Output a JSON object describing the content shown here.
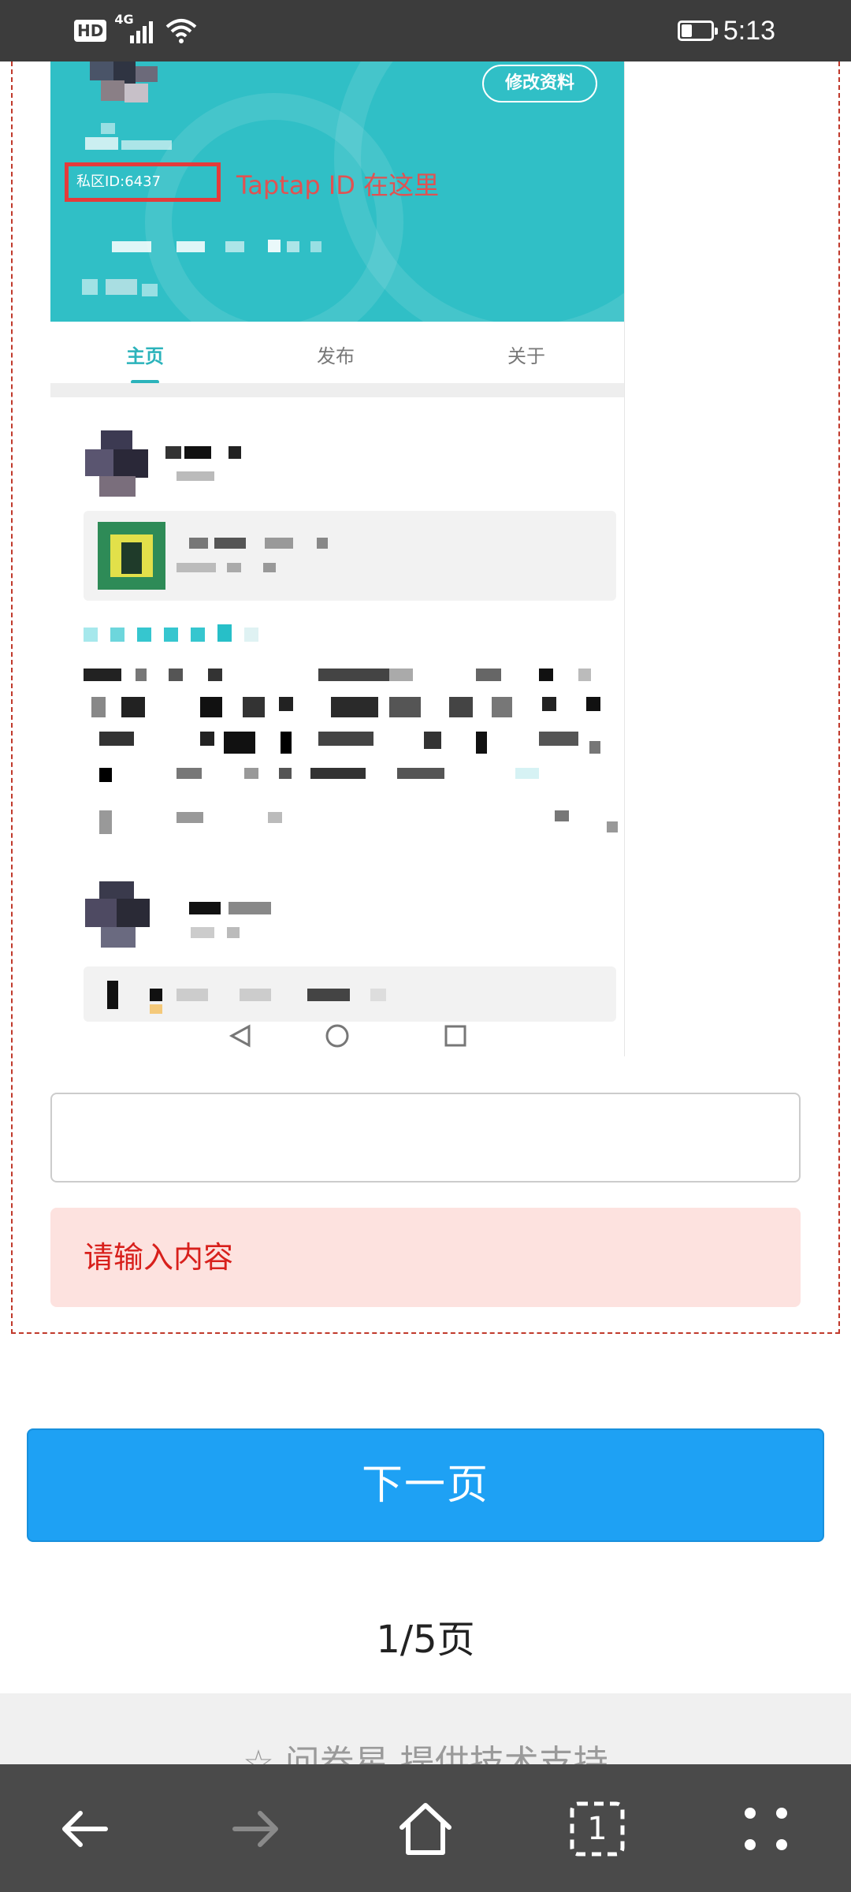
{
  "status_bar": {
    "hd_badge": "HD",
    "network": "4G",
    "time": "5:13",
    "battery_level": 0.35
  },
  "embedded_screenshot": {
    "edit_profile_label": "修改资料",
    "id_label": "私区ID:6437",
    "id_note": "Taptap ID 在这里",
    "tabs": [
      "主页",
      "发布",
      "关于"
    ],
    "active_tab": "主页"
  },
  "answer": {
    "value": "",
    "placeholder": ""
  },
  "error_message": "请输入内容",
  "next_button_label": "下一页",
  "page_indicator": "1/5页",
  "footer_text": "问卷星 提供技术支持",
  "browser_nav": {
    "tab_count": "1"
  },
  "colors": {
    "primary_button": "#1ea1f4",
    "error_text": "#d8201c",
    "error_bg": "#fde2df",
    "profile_header": "#30bfc6"
  }
}
